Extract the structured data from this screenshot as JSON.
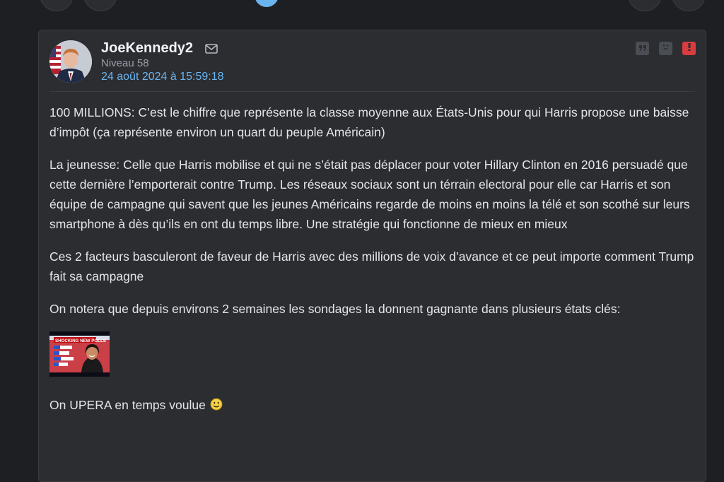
{
  "post": {
    "author": {
      "username": "JoeKennedy2",
      "level": "Niveau 58",
      "date": "24 août 2024 à 15:59:18"
    },
    "paragraphs": [
      "100 MILLIONS: C’est le chiffre que représente la classe moyenne aux États-Unis pour qui Harris propose une baisse d’impôt (ça représente environ un quart du peuple Américain)",
      "La jeunesse: Celle que Harris mobilise et qui ne s’était pas déplacer pour voter Hillary Clinton en 2016 persuadé que cette dernière l’emporterait contre Trump. Les réseaux sociaux sont un térrain electoral pour elle car Harris et son équipe de campagne qui savent que les jeunes Américains regarde de moins en moins la télé et son scothé sur leurs smartphone à dès qu’ils en ont du temps libre. Une stratégie qui fonctionne de mieux en mieux",
      "Ces 2 facteurs basculeront de faveur de Harris avec des millions de voix d’avance et ce peut importe comment Trump fait sa campagne",
      "On notera que depuis environs 2 semaines les sondages la donnent gagnante dans plusieurs états clés:"
    ],
    "image_caption": "SHOCKING NEW POLLS",
    "closing": "On UPERA en temps voulue"
  },
  "icons": {
    "mail": "mail-icon",
    "quote": "quote-icon",
    "sad": "sad-face-icon",
    "report": "alert-icon",
    "smiley": "smiley-icon"
  },
  "colors": {
    "background": "#1e1f22",
    "card": "#2b2d31",
    "accent": "#6cb4ee",
    "alert": "#d83c3e"
  }
}
